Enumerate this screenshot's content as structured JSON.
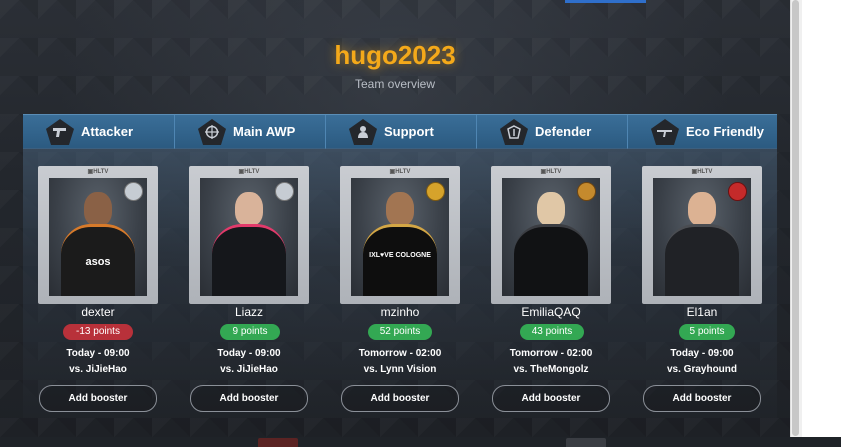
{
  "team": {
    "name": "hugo2023",
    "subtitle": "Team overview"
  },
  "roles": [
    {
      "label": "Attacker",
      "icon": "pistol-icon"
    },
    {
      "label": "Main AWP",
      "icon": "crosshair-icon"
    },
    {
      "label": "Support",
      "icon": "support-icon"
    },
    {
      "label": "Defender",
      "icon": "defender-icon"
    },
    {
      "label": "Eco Friendly",
      "icon": "rifle-icon"
    }
  ],
  "card_badge": "HLTV",
  "players": [
    {
      "name": "dexter",
      "points": "-13 points",
      "points_status": "negative",
      "time": "Today - 09:00",
      "opponent": "vs. JiJieHao",
      "jersey": "asos",
      "team_logo": "wolf-logo"
    },
    {
      "name": "Liazz",
      "points": "9 points",
      "points_status": "positive",
      "time": "Today - 09:00",
      "opponent": "vs. JiJieHao",
      "jersey": "",
      "team_logo": "wolf-logo"
    },
    {
      "name": "mzinho",
      "points": "52 points",
      "points_status": "positive",
      "time": "Tomorrow - 02:00",
      "opponent": "vs. Lynn Vision",
      "jersey": "IXL♥VE COLOGNE",
      "team_logo": "gold-crest-logo"
    },
    {
      "name": "EmiliaQAQ",
      "points": "43 points",
      "points_status": "positive",
      "time": "Tomorrow - 02:00",
      "opponent": "vs. TheMongolz",
      "jersey": "",
      "team_logo": "crown-logo"
    },
    {
      "name": "El1an",
      "points": "5 points",
      "points_status": "positive",
      "time": "Today - 09:00",
      "opponent": "vs. Grayhound",
      "jersey": "",
      "team_logo": "red-beast-logo"
    }
  ],
  "booster_label": "Add booster",
  "colors": {
    "title": "#f4a91a",
    "role_bar": "#2f6188",
    "negative": "#b8313a",
    "positive": "#33a853"
  }
}
